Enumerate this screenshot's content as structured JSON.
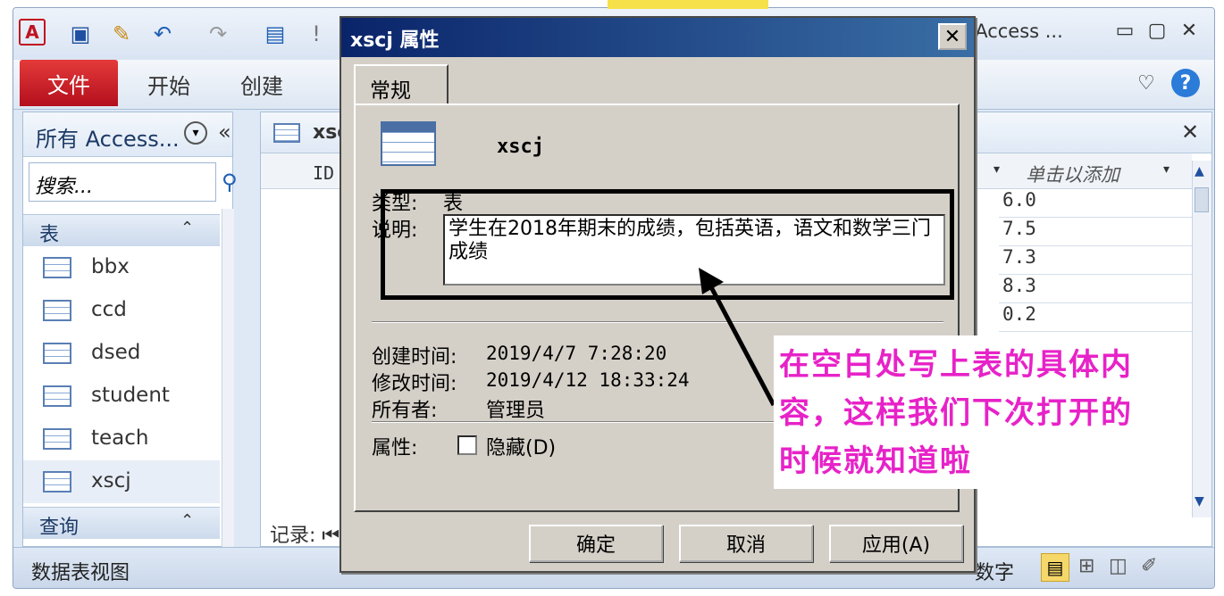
{
  "app": {
    "title": "(Access ...",
    "quick_access": [
      "access-logo-icon",
      "save-icon",
      "edit-icon",
      "undo-icon",
      "redo-icon",
      "form-icon",
      "pin-icon"
    ],
    "ribbon_tabs": {
      "file": "文件",
      "home": "开始",
      "create": "创建"
    },
    "window_buttons": [
      "minimize-icon",
      "restore-icon",
      "close-icon"
    ]
  },
  "nav": {
    "title": "所有 Access...",
    "collapse": "«",
    "search_placeholder": "搜索...",
    "group_tables": "表",
    "group_queries": "查询",
    "tables": [
      "bbx",
      "ccd",
      "dsed",
      "student",
      "teach",
      "xscj"
    ],
    "selected": "xscj"
  },
  "doc": {
    "tab_label": "xsc",
    "col_id": "ID",
    "col_add": "单击以添加",
    "visible_values": [
      "6.0",
      "7.5",
      "7.3",
      "8.3",
      "0.2"
    ],
    "records_label": "记录: ⏮"
  },
  "status": {
    "left": "数据表视图",
    "right": "数字"
  },
  "dialog": {
    "title": "xscj 属性",
    "tab": "常规",
    "object_name": "xscj",
    "type_label": "类型:",
    "type_value": "表",
    "desc_label": "说明:",
    "description": "学生在2018年期末的成绩，包括英语，语文和数学三门成绩",
    "created_label": "创建时间:",
    "created_value": "2019/4/7  7:28:20",
    "modified_label": "修改时间:",
    "modified_value": "2019/4/12  18:33:24",
    "owner_label": "所有者:",
    "owner_value": "管理员",
    "attr_label": "属性:",
    "hidden_label": "隐藏(D)",
    "ok": "确定",
    "cancel": "取消",
    "apply": "应用(A)"
  },
  "annotation": {
    "callout": "在空白处写上表的具体内容，这样我们下次打开的时候就知道啦",
    "callout_color": "#e722c8"
  }
}
